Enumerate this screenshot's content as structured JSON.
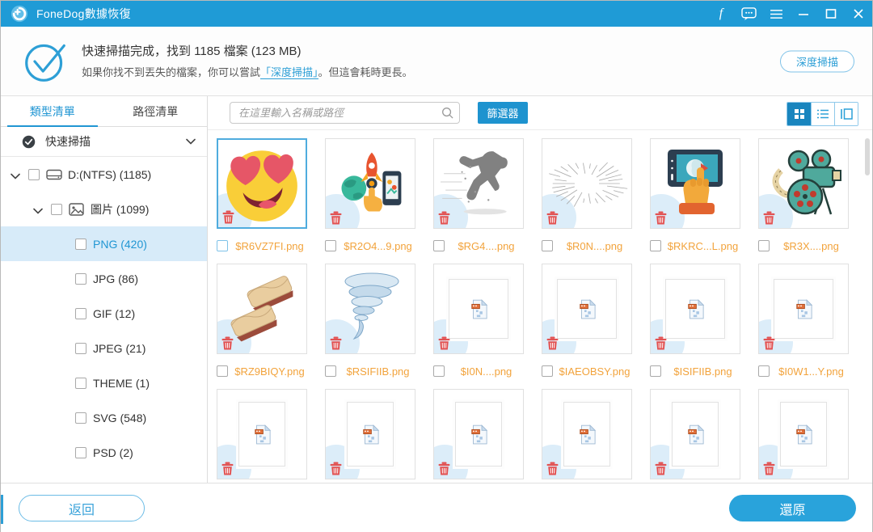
{
  "titlebar": {
    "app_title": "FoneDog數據恢復",
    "window_icons": [
      "facebook-icon",
      "chat-icon",
      "menu-icon",
      "minimize-button",
      "maximize-button",
      "close-button"
    ]
  },
  "header": {
    "result_line": "快速掃描完成，找到 1185 檔案 (123 MB)",
    "hint_prefix": "如果你找不到丟失的檔案，你可以嘗試",
    "hint_link": "「深度掃描」",
    "hint_suffix": "。但這會耗時更長。",
    "deep_scan_button": "深度掃描"
  },
  "sidebar": {
    "tabs": [
      {
        "label": "類型清單",
        "active": true
      },
      {
        "label": "路徑清單",
        "active": false
      }
    ],
    "scan_mode_label": "快速掃描",
    "tree": [
      {
        "label": "D:(NTFS) (1185)",
        "level": 0,
        "icon": "drive",
        "expanded": true,
        "selected": false
      },
      {
        "label": "圖片 (1099)",
        "level": 1,
        "icon": "image",
        "expanded": true,
        "selected": false
      },
      {
        "label": "PNG (420)",
        "level": 2,
        "icon": null,
        "expanded": null,
        "selected": true
      },
      {
        "label": "JPG (86)",
        "level": 2,
        "icon": null,
        "expanded": null,
        "selected": false
      },
      {
        "label": "GIF (12)",
        "level": 2,
        "icon": null,
        "expanded": null,
        "selected": false
      },
      {
        "label": "JPEG (21)",
        "level": 2,
        "icon": null,
        "expanded": null,
        "selected": false
      },
      {
        "label": "THEME (1)",
        "level": 2,
        "icon": null,
        "expanded": null,
        "selected": false
      },
      {
        "label": "SVG (548)",
        "level": 2,
        "icon": null,
        "expanded": null,
        "selected": false
      },
      {
        "label": "PSD (2)",
        "level": 2,
        "icon": null,
        "expanded": null,
        "selected": false
      }
    ]
  },
  "toolbar": {
    "search_placeholder": "在這里輸入名稱或路徑",
    "search_value": "",
    "filter_button": "篩選器",
    "view_modes": [
      {
        "icon": "grid-view-icon",
        "active": true
      },
      {
        "icon": "list-view-icon",
        "active": false
      },
      {
        "icon": "column-view-icon",
        "active": false
      }
    ]
  },
  "grid": {
    "tiles": [
      {
        "name": "$R6VZ7FI.png",
        "art": "heart-eyes-emoji",
        "selected": true
      },
      {
        "name": "$R2O4...9.png",
        "art": "rocket-launch",
        "selected": false
      },
      {
        "name": "$RG4....png",
        "art": "running-man",
        "selected": false
      },
      {
        "name": "$R0N....png",
        "art": "burst-lines",
        "selected": false
      },
      {
        "name": "$RKRC...L.png",
        "art": "tablet-touch",
        "selected": false
      },
      {
        "name": "$R3X....png",
        "art": "movie-camera",
        "selected": false
      },
      {
        "name": "$RZ9BIQY.png",
        "art": "parchment-books",
        "selected": false
      },
      {
        "name": "$RSIFIIB.png",
        "art": "tornado",
        "selected": false
      },
      {
        "name": "$I0N....png",
        "art": "placeholder",
        "selected": false
      },
      {
        "name": "$IAEOBSY.png",
        "art": "placeholder",
        "selected": false
      },
      {
        "name": "$ISIFIIB.png",
        "art": "placeholder",
        "selected": false
      },
      {
        "name": "$I0W1...Y.png",
        "art": "placeholder",
        "selected": false
      },
      {
        "name": "",
        "art": "placeholder-tall",
        "selected": false
      },
      {
        "name": "",
        "art": "placeholder-tall",
        "selected": false
      },
      {
        "name": "",
        "art": "placeholder-tall",
        "selected": false
      },
      {
        "name": "",
        "art": "placeholder-tall",
        "selected": false
      },
      {
        "name": "",
        "art": "placeholder-tall",
        "selected": false
      },
      {
        "name": "",
        "art": "placeholder-tall",
        "selected": false
      }
    ]
  },
  "footer": {
    "back_button": "返回",
    "restore_button": "還原"
  },
  "colors": {
    "titlebar_blue": "#1F9BD6",
    "accent_blue": "#2D9FD6",
    "filename_orange": "#F2A33C",
    "selected_row_bg": "#D7EBF9",
    "trash_red": "#E25252"
  }
}
